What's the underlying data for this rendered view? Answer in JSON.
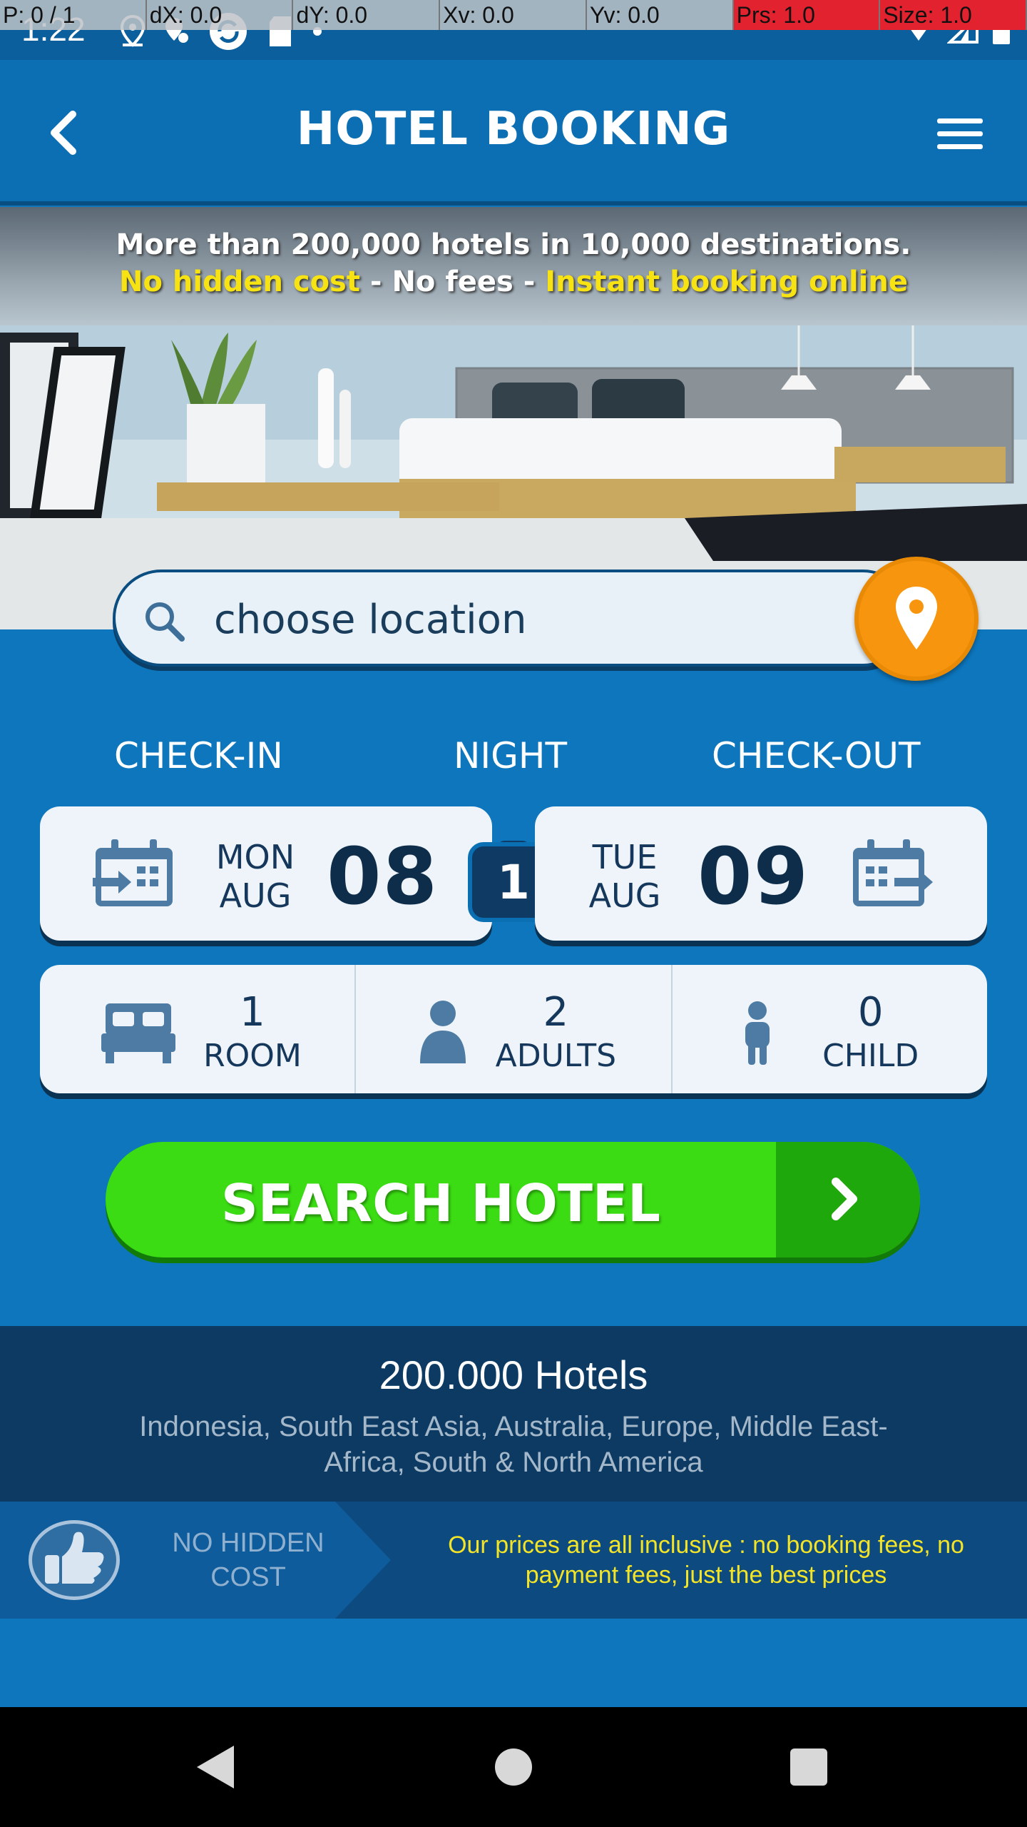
{
  "status_bar": {
    "time": "1:22",
    "debug": [
      {
        "text": "P: 0 / 1",
        "highlight": false
      },
      {
        "text": "dX: 0.0",
        "highlight": false
      },
      {
        "text": "dY: 0.0",
        "highlight": false
      },
      {
        "text": "Xv: 0.0",
        "highlight": false
      },
      {
        "text": "Yv: 0.0",
        "highlight": false
      },
      {
        "text": "Prs: 1.0",
        "highlight": true
      },
      {
        "text": "Size: 1.0",
        "highlight": true
      }
    ]
  },
  "app_bar": {
    "title": "HOTEL BOOKING"
  },
  "banner": {
    "line1": "More than 200,000 hotels in 10,000 destinations.",
    "line2_part1": "No hidden cost",
    "line2_sep1": " - No fees - ",
    "line2_part2": "Instant booking online"
  },
  "search": {
    "placeholder": "choose location"
  },
  "dates": {
    "checkin_label": "CHECK-IN",
    "night_label": "NIGHT",
    "checkout_label": "CHECK-OUT",
    "checkin": {
      "weekday": "MON",
      "month": "AUG",
      "day": "08"
    },
    "checkout": {
      "weekday": "TUE",
      "month": "AUG",
      "day": "09"
    },
    "nights": "1"
  },
  "guests": {
    "rooms": {
      "count": "1",
      "label": "ROOM"
    },
    "adults": {
      "count": "2",
      "label": "ADULTS"
    },
    "children": {
      "count": "0",
      "label": "CHILD"
    }
  },
  "search_button": {
    "label": "SEARCH HOTEL"
  },
  "hotels_info": {
    "title": "200.000 Hotels",
    "regions": "Indonesia, South East Asia, Australia, Europe, Middle East-Africa, South & North America"
  },
  "no_hidden_cost": {
    "label": "NO HIDDEN COST",
    "text": "Our prices are all inclusive : no booking fees, no payment fees, just the best prices"
  },
  "colors": {
    "primary_blue": "#0d76bd",
    "accent_orange": "#f7950f",
    "search_green": "#3bdc13",
    "highlight_yellow": "#f7e313"
  }
}
